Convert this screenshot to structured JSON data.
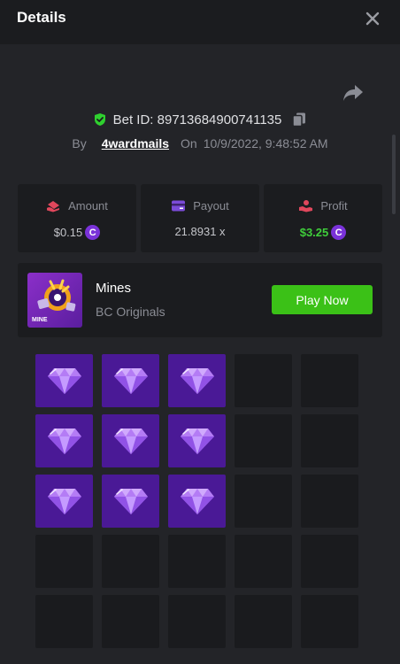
{
  "header": {
    "title": "Details"
  },
  "bet": {
    "id_text": "Bet ID: 89713684900741135",
    "by_label": "By",
    "username": "4wardmails",
    "on_label": "On",
    "datetime": "10/9/2022, 9:48:52 AM"
  },
  "stats": {
    "amount": {
      "label": "Amount",
      "value": "$0.15"
    },
    "payout": {
      "label": "Payout",
      "value": "21.8931 x"
    },
    "profit": {
      "label": "Profit",
      "value": "$3.25"
    }
  },
  "game": {
    "name": "Mines",
    "provider": "BC Originals",
    "thumb_label": "MINE",
    "play_label": "Play Now"
  },
  "board": {
    "rows": [
      [
        "gem",
        "gem",
        "gem",
        "empty",
        "empty"
      ],
      [
        "gem",
        "gem",
        "gem",
        "empty",
        "empty"
      ],
      [
        "gem",
        "gem",
        "gem",
        "empty",
        "empty"
      ],
      [
        "empty",
        "empty",
        "empty",
        "empty",
        "empty"
      ],
      [
        "empty",
        "empty",
        "empty",
        "empty",
        "empty"
      ]
    ]
  },
  "colors": {
    "accent_green": "#3bc117",
    "gem_tile": "#4a1996",
    "coin": "#7a32d9"
  }
}
